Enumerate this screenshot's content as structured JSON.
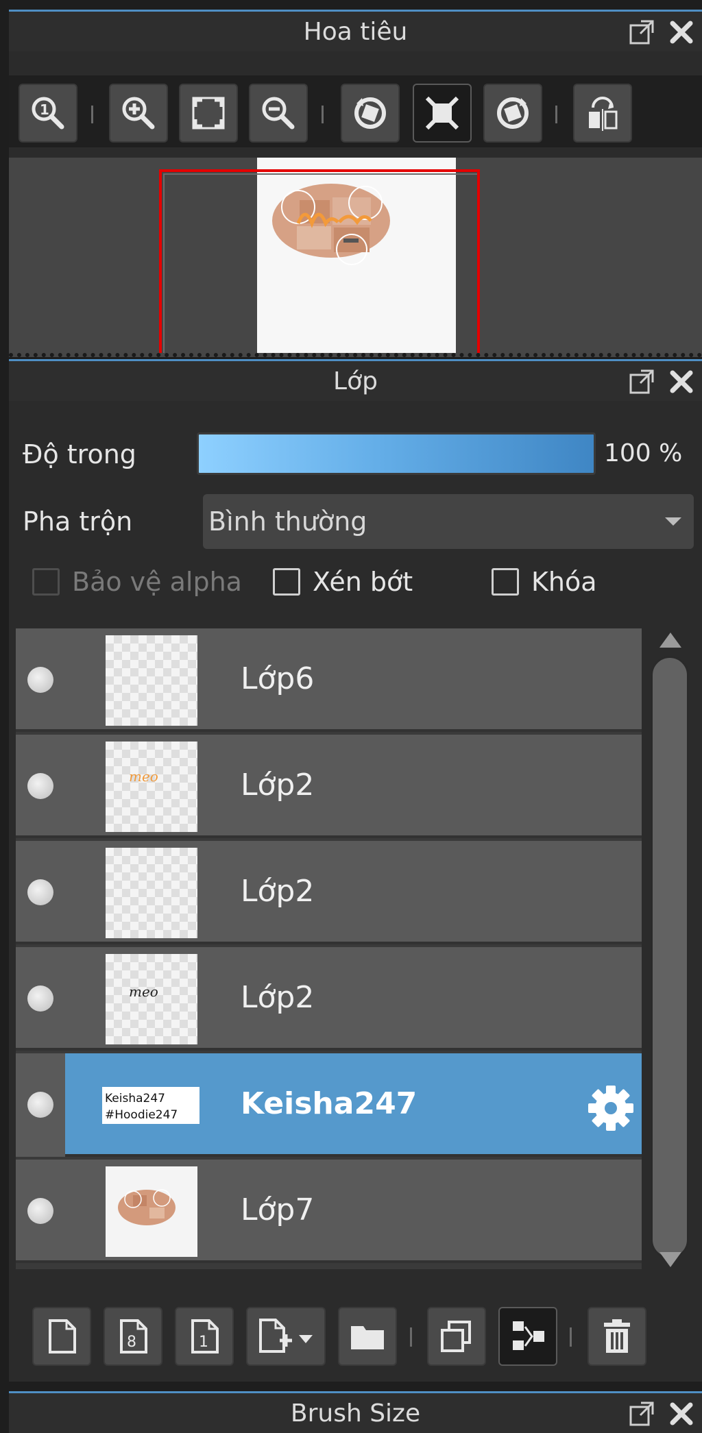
{
  "navigator": {
    "title": "Hoa tiêu",
    "toolbar_icons": [
      "zoom-actual-icon",
      "zoom-in-icon",
      "fit-screen-icon",
      "zoom-out-icon",
      "rotate-left-icon",
      "fullscreen-icon",
      "rotate-right-icon",
      "flip-horizontal-icon"
    ]
  },
  "layers_panel": {
    "title": "Lớp",
    "opacity_label": "Độ trong",
    "opacity_value": "100 %",
    "opacity_fraction": 1.0,
    "blend_label": "Pha trộn",
    "blend_value": "Bình thường",
    "protect_alpha_label": "Bảo vệ alpha",
    "clipping_label": "Xén bớt",
    "lock_label": "Khóa",
    "layers": [
      {
        "name": "Lớp6",
        "selected": false
      },
      {
        "name": "Lớp2",
        "selected": false
      },
      {
        "name": "Lớp2",
        "selected": false
      },
      {
        "name": "Lớp2",
        "selected": false
      },
      {
        "name": "Keisha247",
        "selected": true
      },
      {
        "name": "Lớp7",
        "selected": false
      }
    ],
    "thumb_text": {
      "meo": "meo",
      "keisha_line1": "Keisha247",
      "keisha_line2": "#Hoodie247"
    },
    "bottom_toolbar_icons": [
      "new-layer-icon",
      "new-8bit-layer-icon",
      "new-1bit-layer-icon",
      "add-layer-menu-icon",
      "new-folder-icon",
      "duplicate-layer-icon",
      "merge-down-icon",
      "delete-layer-icon"
    ]
  },
  "brush_panel": {
    "title": "Brush Size"
  },
  "colors": {
    "accent": "#4f8fc4",
    "selected_row": "#5599cc",
    "nav_frame": "#e40000"
  }
}
